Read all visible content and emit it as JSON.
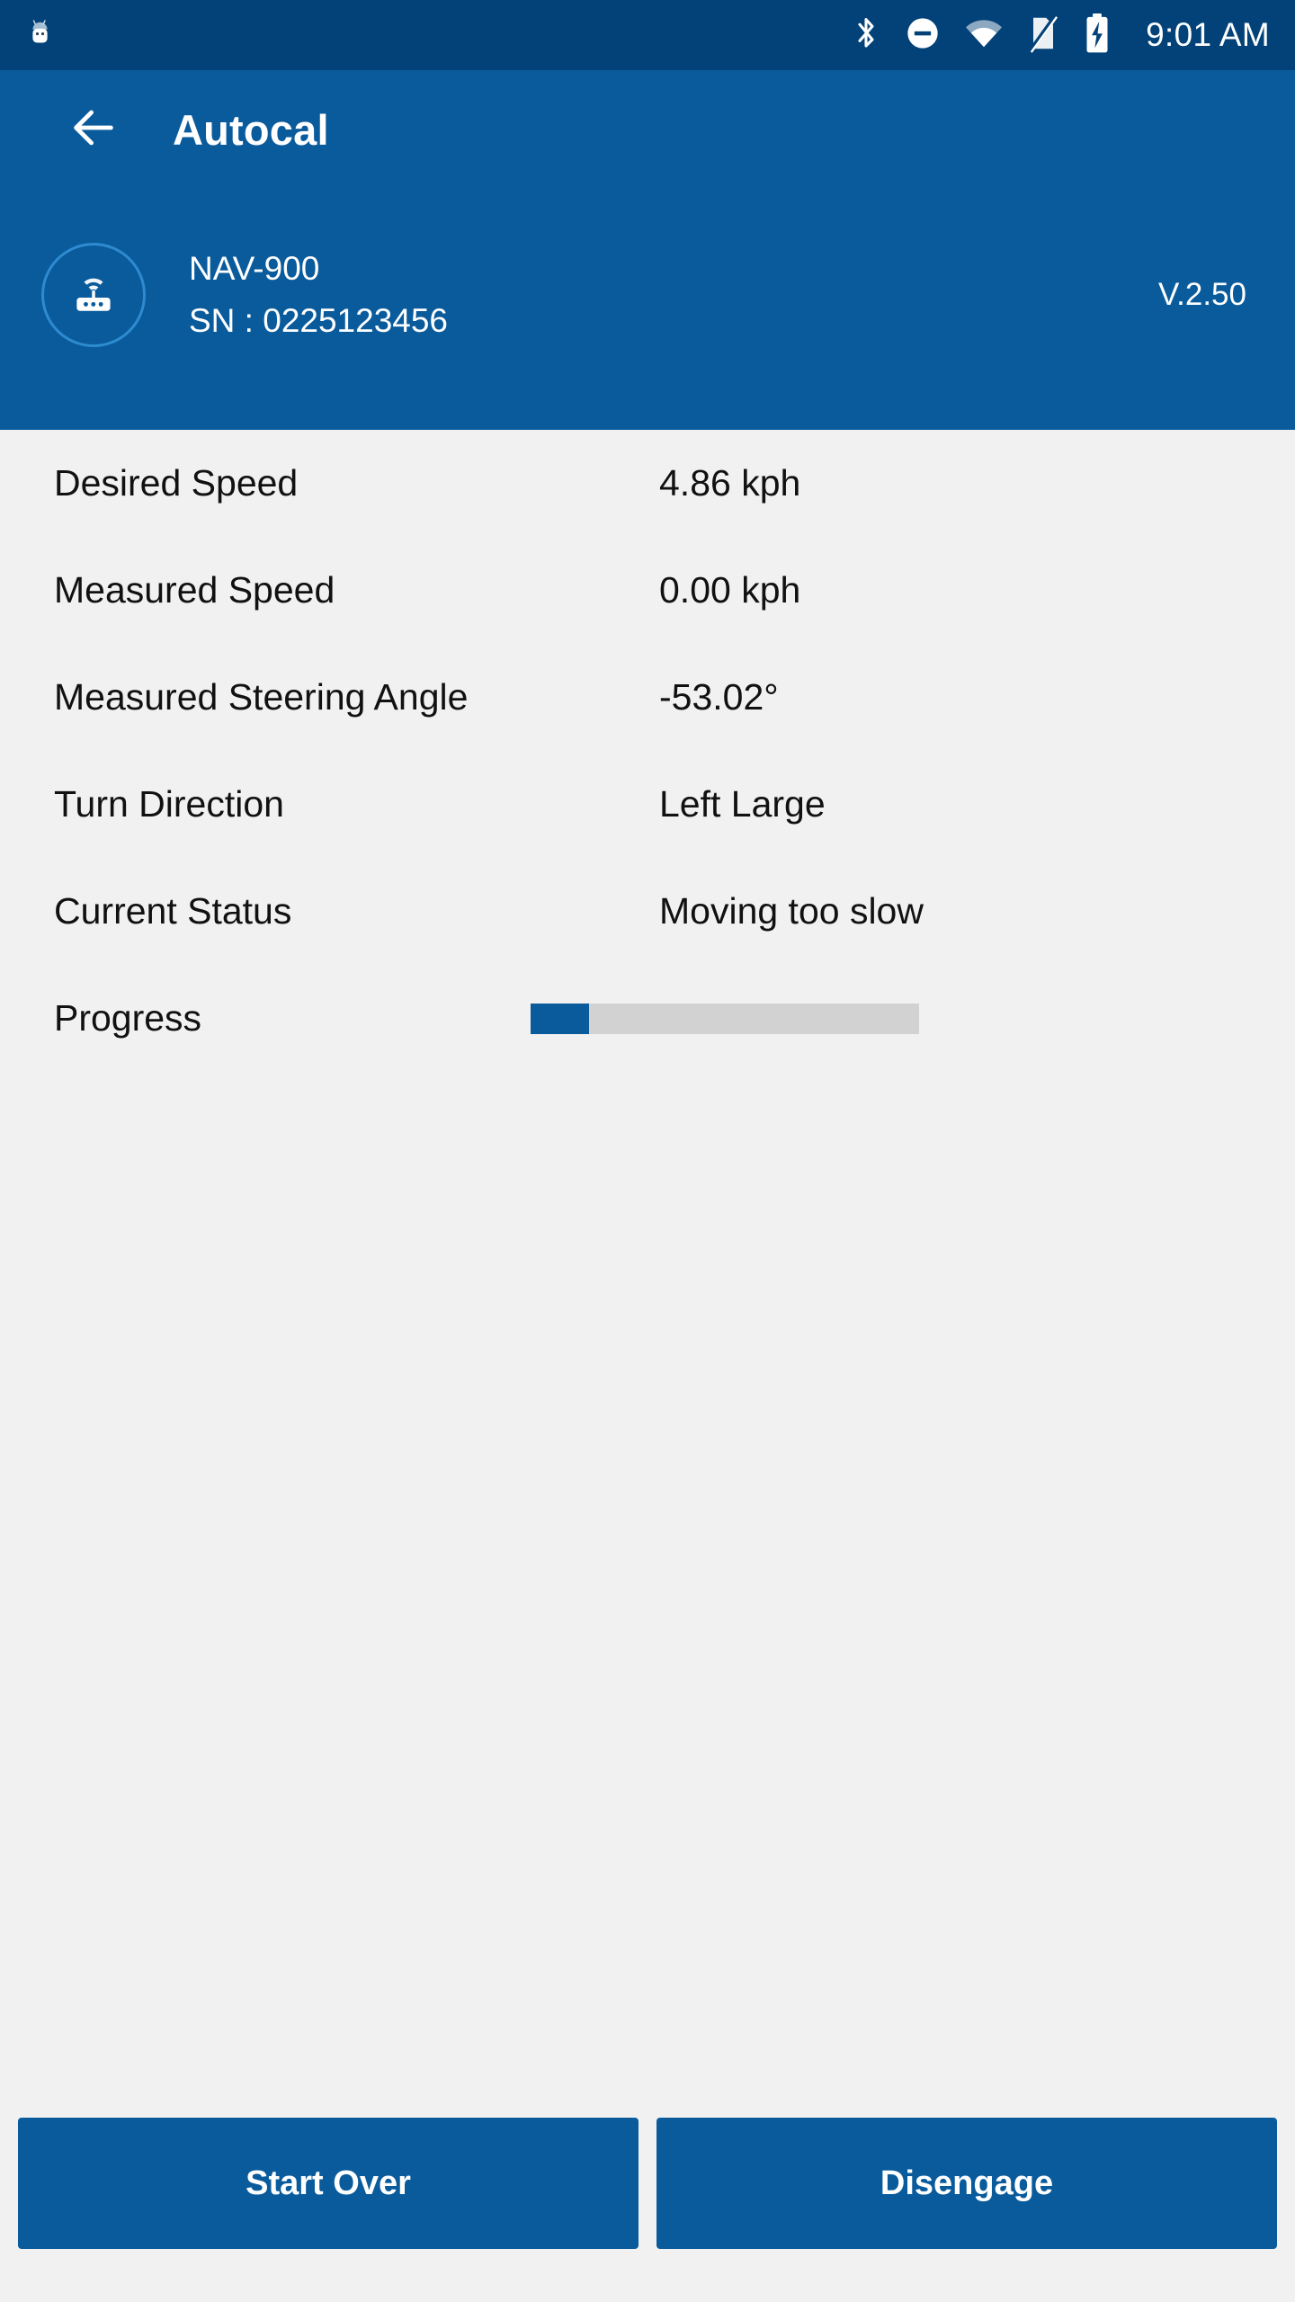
{
  "status_bar": {
    "notification_icon": "android-robot-icon",
    "icons": [
      "bluetooth-icon",
      "do-not-disturb-icon",
      "wifi-icon",
      "sim-card-off-icon",
      "battery-charging-icon"
    ],
    "time": "9:01 AM",
    "background_color": "#034278"
  },
  "app_bar": {
    "back_icon": "back-arrow-icon",
    "title": "Autocal",
    "background_color": "#0a5b9c"
  },
  "device": {
    "icon": "router-wifi-icon",
    "name": "NAV-900",
    "serial": "SN :  0225123456",
    "version": "V.2.50"
  },
  "rows": [
    {
      "label": "Desired Speed",
      "value": "4.86 kph"
    },
    {
      "label": "Measured Speed",
      "value": "0.00 kph"
    },
    {
      "label": "Measured Steering Angle",
      "value": "-53.02°"
    },
    {
      "label": "Turn Direction",
      "value": "Left Large"
    },
    {
      "label": "Current Status",
      "value": "Moving too slow"
    }
  ],
  "progress": {
    "label": "Progress",
    "percent": 15,
    "fill_color": "#0a5b9c",
    "track_color": "#d2d2d2"
  },
  "buttons": {
    "start_over": "Start Over",
    "disengage": "Disengage"
  },
  "colors": {
    "accent": "#0a5b9c",
    "status_bar": "#034278",
    "background": "#f1f1f1",
    "text": "#111111"
  }
}
